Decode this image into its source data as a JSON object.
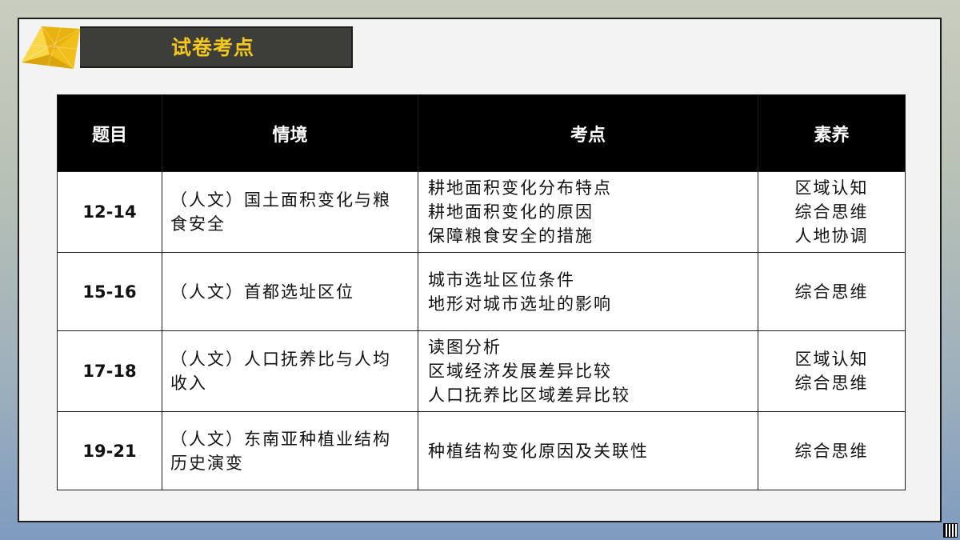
{
  "header": {
    "title": "试卷考点"
  },
  "table": {
    "headers": [
      "题目",
      "情境",
      "考点",
      "素养"
    ],
    "rows": [
      {
        "question": "12-14",
        "context": [
          "（人文）国土面积变化与粮",
          "食安全"
        ],
        "points": [
          "耕地面积变化分布特点",
          "耕地面积变化的原因",
          "保障粮食安全的措施"
        ],
        "literacy": [
          "区域认知",
          "综合思维",
          "人地协调"
        ]
      },
      {
        "question": "15-16",
        "context": [
          "（人文）首都选址区位"
        ],
        "points": [
          "城市选址区位条件",
          "地形对城市选址的影响"
        ],
        "literacy": [
          "综合思维"
        ]
      },
      {
        "question": "17-18",
        "context": [
          "（人文）人口抚养比与人均",
          "收入"
        ],
        "points": [
          "读图分析",
          "区域经济发展差异比较",
          "人口抚养比区域差异比较"
        ],
        "literacy": [
          "区域认知",
          "综合思维"
        ]
      },
      {
        "question": "19-21",
        "context": [
          "（人文）东南亚种植业结构",
          "历史演变"
        ],
        "points": [
          "种植结构变化原因及关联性"
        ],
        "literacy": [
          "综合思维"
        ]
      }
    ]
  },
  "colors": {
    "title_bar_bg": "#3d3d39",
    "title_text": "#f3c71d",
    "header_bg": "#000000",
    "logo_yellow": "#f5c518"
  },
  "icons": {
    "logo": "yellow-geometric-logo-icon",
    "qr": "qr-code-icon"
  }
}
